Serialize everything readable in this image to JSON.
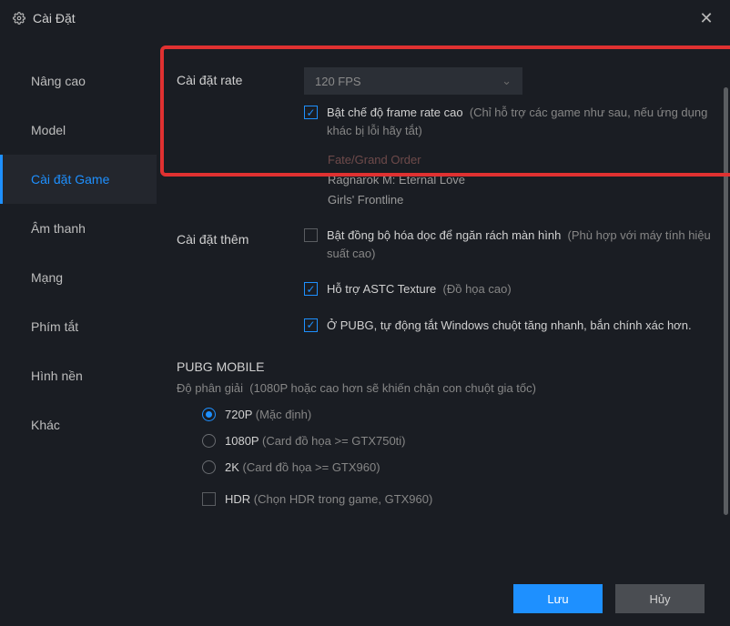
{
  "window": {
    "title": "Cài Đặt"
  },
  "sidebar": {
    "items": [
      {
        "label": "Nâng cao"
      },
      {
        "label": "Model"
      },
      {
        "label": "Cài đặt Game"
      },
      {
        "label": "Âm thanh"
      },
      {
        "label": "Mạng"
      },
      {
        "label": "Phím tắt"
      },
      {
        "label": "Hình nền"
      },
      {
        "label": "Khác"
      }
    ],
    "active_index": 2
  },
  "rate": {
    "label": "Cài đặt rate",
    "value": "120 FPS",
    "high_fps": {
      "checked": true,
      "text": "Bật chế độ frame rate cao",
      "hint": "(Chỉ hỗ trợ các game như sau, nếu ứng dụng khác bị lỗi hãy tắt)"
    },
    "games": {
      "g1": "Fate/Grand Order",
      "g2": "Ragnarok M: Eternal Love",
      "g3": "Girls' Frontline"
    }
  },
  "extra": {
    "label": "Cài đặt thêm",
    "vsync": {
      "checked": false,
      "text": "Bật đồng bộ hóa dọc để ngăn rách màn hình",
      "hint": "(Phù hợp với máy tính hiệu suất cao)"
    },
    "astc": {
      "checked": true,
      "text": "Hỗ trợ ASTC Texture",
      "hint": "(Đồ họa cao)"
    },
    "pubg_mouse": {
      "checked": true,
      "text": "Ở PUBG, tự động tắt Windows chuột tăng nhanh, bắn chính xác hơn."
    }
  },
  "pubg": {
    "header": "PUBG MOBILE",
    "res_label": "Độ phân giải",
    "res_hint": "(1080P hoặc cao hơn sẽ khiến chặn con chuột gia tốc)",
    "options": {
      "r720": {
        "text": "720P",
        "hint": "(Mặc định)",
        "selected": true
      },
      "r1080": {
        "text": "1080P",
        "hint": "(Card đồ họa >= GTX750ti)",
        "selected": false
      },
      "r2k": {
        "text": "2K",
        "hint": "(Card đồ họa >= GTX960)",
        "selected": false
      }
    },
    "hdr": {
      "checked": false,
      "text": "HDR",
      "hint": "(Chọn HDR trong game, GTX960)"
    }
  },
  "footer": {
    "save": "Lưu",
    "cancel": "Hủy"
  }
}
